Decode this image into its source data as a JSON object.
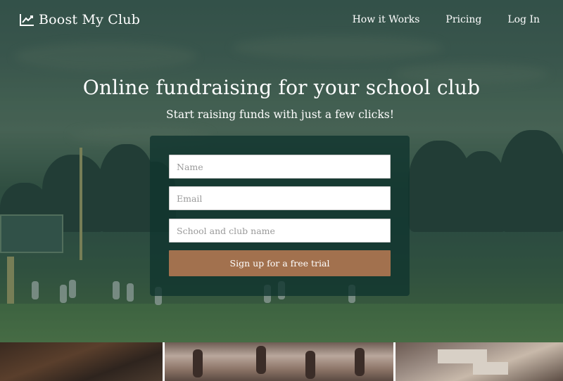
{
  "navbar": {
    "brand": "Boost My Club",
    "brand_icon": "line-chart-icon",
    "links": [
      "How it Works",
      "Pricing",
      "Log In"
    ]
  },
  "hero": {
    "headline": "Online fundraising for your school club",
    "subhead": "Start raising funds with just a few clicks!"
  },
  "signup_form": {
    "name_placeholder": "Name",
    "email_placeholder": "Email",
    "club_placeholder": "School and club name",
    "submit_label": "Sign up for a free trial"
  },
  "colors": {
    "accent_button": "#a2714e",
    "card_background": "#10342e",
    "text": "#ffffff"
  }
}
